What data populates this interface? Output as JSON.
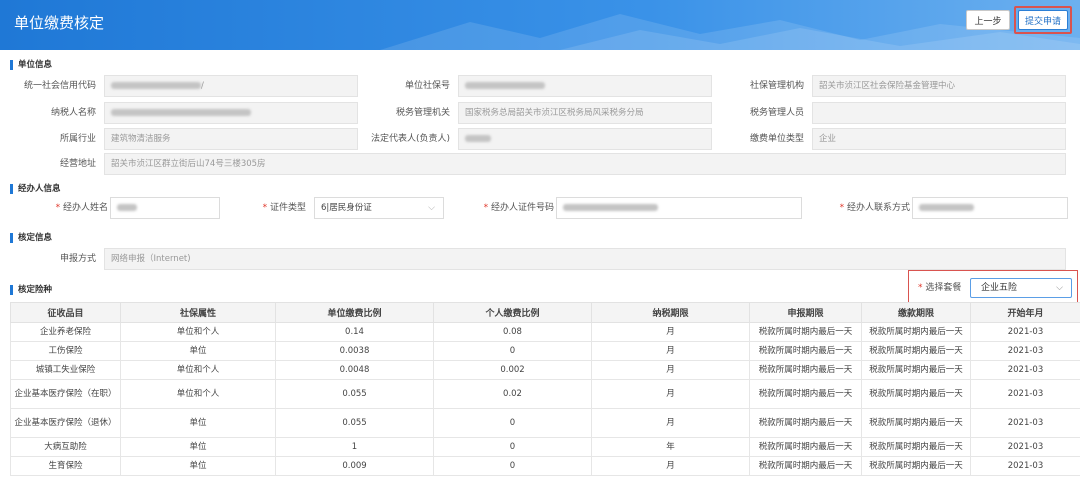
{
  "page": {
    "title": "单位缴费核定"
  },
  "toolbar": {
    "prev_label": "上一步",
    "submit_label": "提交申请"
  },
  "unit_info": {
    "section_title": "单位信息",
    "fields": [
      {
        "label": "统一社会信用代码",
        "value": "/"
      },
      {
        "label": "单位社保号",
        "value": ""
      },
      {
        "label": "社保管理机构",
        "value": "韶关市浈江区社会保险基金管理中心"
      },
      {
        "label": "纳税人名称",
        "value": ""
      },
      {
        "label": "税务管理机关",
        "value": "国家税务总局韶关市浈江区税务局风采税务分局"
      },
      {
        "label": "税务管理人员",
        "value": ""
      },
      {
        "label": "所属行业",
        "value": "建筑物清洁服务"
      },
      {
        "label": "法定代表人(负责人)",
        "value": ""
      },
      {
        "label": "缴费单位类型",
        "value": "企业"
      },
      {
        "label": "经营地址",
        "value": "韶关市浈江区群立街后山74号三楼305房"
      }
    ]
  },
  "agent_info": {
    "section_title": "经办人信息",
    "name_label": "经办人姓名",
    "id_type_label": "证件类型",
    "id_type_value": "6|居民身份证",
    "id_no_label": "经办人证件号码",
    "phone_label": "经办人联系方式"
  },
  "verify_info": {
    "section_title": "核定信息",
    "method_label": "申报方式",
    "method_value": "网络申报（Internet)"
  },
  "tax_types": {
    "section_title": "核定险种",
    "package_label": "选择套餐",
    "package_value": "企业五险",
    "headers": [
      "征收品目",
      "社保属性",
      "单位缴费比例",
      "个人缴费比例",
      "纳税期限",
      "申报期限",
      "缴款期限",
      "开始年月"
    ],
    "rows": [
      [
        "企业养老保险",
        "单位和个人",
        "0.14",
        "0.08",
        "月",
        "税款所属时期内最后一天",
        "税款所属时期内最后一天",
        "2021-03"
      ],
      [
        "工伤保险",
        "单位",
        "0.0038",
        "0",
        "月",
        "税款所属时期内最后一天",
        "税款所属时期内最后一天",
        "2021-03"
      ],
      [
        "城镇工失业保险",
        "单位和个人",
        "0.0048",
        "0.002",
        "月",
        "税款所属时期内最后一天",
        "税款所属时期内最后一天",
        "2021-03"
      ],
      [
        "企业基本医疗保险（在职）",
        "单位和个人",
        "0.055",
        "0.02",
        "月",
        "税款所属时期内最后一天",
        "税款所属时期内最后一天",
        "2021-03"
      ],
      [
        "企业基本医疗保险（退休）",
        "单位",
        "0.055",
        "0",
        "月",
        "税款所属时期内最后一天",
        "税款所属时期内最后一天",
        "2021-03"
      ],
      [
        "大病互助险",
        "单位",
        "1",
        "0",
        "年",
        "税款所属时期内最后一天",
        "税款所属时期内最后一天",
        "2021-03"
      ],
      [
        "生育保险",
        "单位",
        "0.009",
        "0",
        "月",
        "税款所属时期内最后一天",
        "税款所属时期内最后一天",
        "2021-03"
      ]
    ]
  }
}
